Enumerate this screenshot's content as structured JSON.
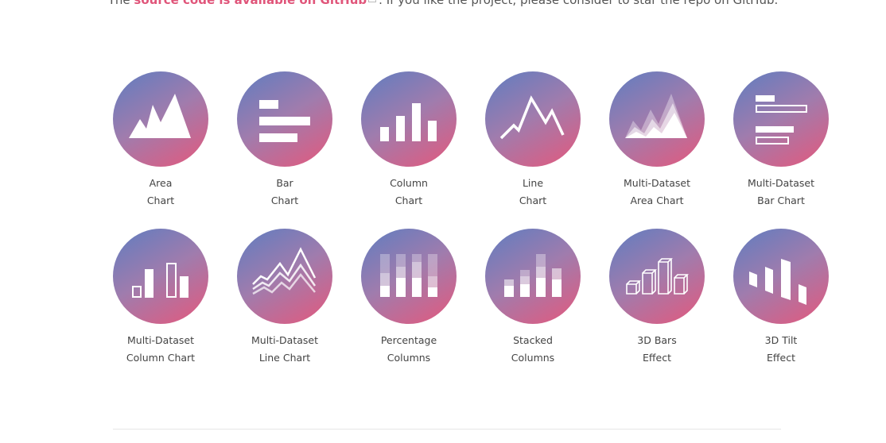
{
  "intro": {
    "prefix": "The ",
    "link": "source code is available on GitHub",
    "suffix": ". If you like the project, please consider to star the repo on GitHub."
  },
  "colors": {
    "gradient_start": "#5f7dc0",
    "gradient_end": "#e5587c",
    "link": "#e0557a"
  },
  "cards": [
    {
      "line1": "Area",
      "line2": "Chart",
      "icon": "area-chart-icon"
    },
    {
      "line1": "Bar",
      "line2": "Chart",
      "icon": "bar-chart-icon"
    },
    {
      "line1": "Column",
      "line2": "Chart",
      "icon": "column-chart-icon"
    },
    {
      "line1": "Line",
      "line2": "Chart",
      "icon": "line-chart-icon"
    },
    {
      "line1": "Multi-Dataset",
      "line2": "Area Chart",
      "icon": "multi-area-chart-icon"
    },
    {
      "line1": "Multi-Dataset",
      "line2": "Bar Chart",
      "icon": "multi-bar-chart-icon"
    },
    {
      "line1": "Multi-Dataset",
      "line2": "Column Chart",
      "icon": "multi-column-chart-icon"
    },
    {
      "line1": "Multi-Dataset",
      "line2": "Line Chart",
      "icon": "multi-line-chart-icon"
    },
    {
      "line1": "Percentage",
      "line2": "Columns",
      "icon": "percentage-columns-icon"
    },
    {
      "line1": "Stacked",
      "line2": "Columns",
      "icon": "stacked-columns-icon"
    },
    {
      "line1": "3D Bars",
      "line2": "Effect",
      "icon": "3d-bars-icon"
    },
    {
      "line1": "3D Tilt",
      "line2": "Effect",
      "icon": "3d-tilt-icon"
    }
  ]
}
